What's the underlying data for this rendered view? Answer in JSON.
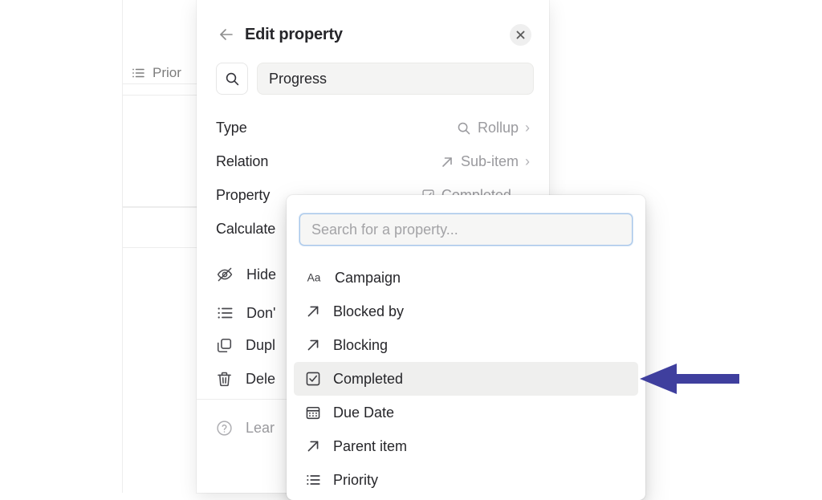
{
  "background": {
    "column_header": {
      "label": "Prior",
      "icon": "list-icon"
    }
  },
  "edit_panel": {
    "title": "Edit property",
    "back_icon": "arrow-left-icon",
    "close_icon": "close-icon",
    "name_search_icon": "search-icon",
    "name_value": "Progress",
    "config_rows": [
      {
        "label": "Type",
        "value": "Rollup",
        "icon": "search-icon",
        "chevron": "›"
      },
      {
        "label": "Relation",
        "value": "Sub-item",
        "icon": "arrow-up-right-icon",
        "chevron": "›"
      },
      {
        "label": "Property",
        "value": "Completed",
        "icon": "checkbox-checked-icon",
        "chevron": "⌄"
      },
      {
        "label": "Calculate",
        "value": "",
        "icon": "",
        "chevron": ""
      }
    ],
    "actions": [
      {
        "label": "Hide",
        "icon": "eye-off-icon"
      },
      {
        "label": "Don'",
        "icon": "list-icon"
      },
      {
        "label": "Dupl",
        "icon": "duplicate-icon"
      },
      {
        "label": "Dele",
        "icon": "trash-icon"
      }
    ],
    "learn": {
      "label": "Lear",
      "icon": "help-circle-icon"
    }
  },
  "property_dropdown": {
    "search_placeholder": "Search for a property...",
    "items": [
      {
        "label": "Campaign",
        "icon": "text-aa-icon",
        "selected": false
      },
      {
        "label": "Blocked by",
        "icon": "arrow-up-right-icon",
        "selected": false
      },
      {
        "label": "Blocking",
        "icon": "arrow-up-right-icon",
        "selected": false
      },
      {
        "label": "Completed",
        "icon": "checkbox-checked-icon",
        "selected": true
      },
      {
        "label": "Due Date",
        "icon": "calendar-icon",
        "selected": false
      },
      {
        "label": "Parent item",
        "icon": "arrow-up-right-icon",
        "selected": false
      },
      {
        "label": "Priority",
        "icon": "list-icon",
        "selected": false
      }
    ]
  },
  "annotation": {
    "arrow_color": "#3f3f9e",
    "points_to": "Completed"
  },
  "colors": {
    "panel_background": "#ffffff",
    "selected_row": "#efefee",
    "focus_ring": "#a8c7ea",
    "text_primary": "#26262a",
    "text_muted": "#9a9a9e",
    "field_background": "#f4f4f3"
  }
}
